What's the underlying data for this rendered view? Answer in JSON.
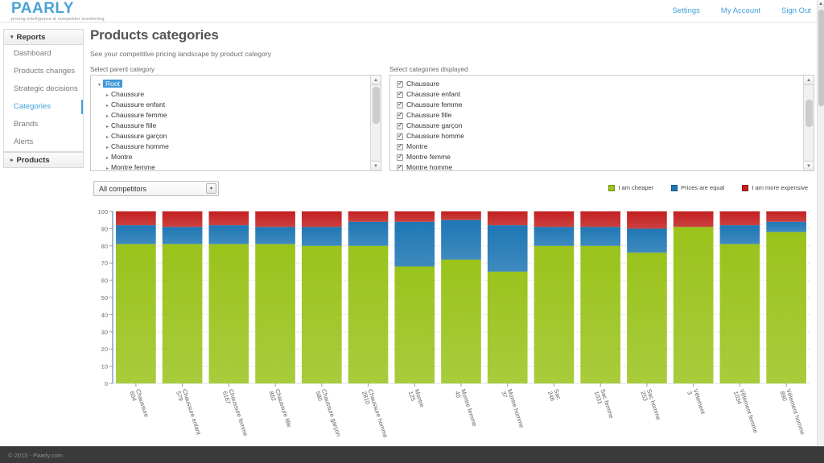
{
  "brand": {
    "name": "PAARLY",
    "tagline": "pricing intelligence & competitor monitoring",
    "accent": "#4aa3d8"
  },
  "topnav": [
    {
      "label": "Settings"
    },
    {
      "label": "My Account"
    },
    {
      "label": "Sign Out"
    }
  ],
  "sidebar": {
    "groups": [
      {
        "label": "Reports",
        "expanded": true,
        "caret": "▾",
        "items": [
          {
            "label": "Dashboard",
            "active": false
          },
          {
            "label": "Products changes",
            "active": false
          },
          {
            "label": "Strategic decisions",
            "active": false
          },
          {
            "label": "Categories",
            "active": true
          },
          {
            "label": "Brands",
            "active": false
          },
          {
            "label": "Alerts",
            "active": false
          }
        ]
      },
      {
        "label": "Products",
        "expanded": false,
        "caret": "▸",
        "items": []
      }
    ]
  },
  "page": {
    "title": "Products categories",
    "subtitle": "See your competitive pricing landscape by product category"
  },
  "parent_category_panel": {
    "label": "Select parent category",
    "root": {
      "label": "Root",
      "selected": true,
      "arrow": "▾"
    },
    "items": [
      {
        "label": "Chaussure",
        "arrow": "▸"
      },
      {
        "label": "Chaussure enfant",
        "arrow": "▸"
      },
      {
        "label": "Chaussure femme",
        "arrow": "▸"
      },
      {
        "label": "Chaussure fille",
        "arrow": "▸"
      },
      {
        "label": "Chaussure garçon",
        "arrow": "▸"
      },
      {
        "label": "Chaussure homme",
        "arrow": "▸"
      },
      {
        "label": "Montre",
        "arrow": "▸"
      },
      {
        "label": "Montre femme",
        "arrow": "▸"
      }
    ]
  },
  "displayed_categories_panel": {
    "label": "Select categories displayed",
    "items": [
      {
        "label": "Chaussure",
        "checked": true
      },
      {
        "label": "Chaussure enfant",
        "checked": true
      },
      {
        "label": "Chaussure femme",
        "checked": true
      },
      {
        "label": "Chaussure fille",
        "checked": true
      },
      {
        "label": "Chaussure garçon",
        "checked": true
      },
      {
        "label": "Chaussure homme",
        "checked": true
      },
      {
        "label": "Montre",
        "checked": true
      },
      {
        "label": "Montre femme",
        "checked": true
      },
      {
        "label": "Montre homme",
        "checked": true
      }
    ]
  },
  "competitor_select": {
    "value": "All competitors",
    "arrow": "▾"
  },
  "chart_data": {
    "type": "bar",
    "stacked": true,
    "title": "",
    "xlabel": "",
    "ylabel": "",
    "ylim": [
      0,
      100
    ],
    "yticks": [
      0,
      10,
      20,
      30,
      40,
      50,
      60,
      70,
      80,
      90,
      100
    ],
    "grid": true,
    "legend_position": "top-right",
    "categories": [
      "Chaussure\n604",
      "Chaussure enfant\n579",
      "Chaussure femme\n6167",
      "Chaussure fille\n862",
      "Chaussure garçon\n580",
      "Chaussure homme\n2810",
      "Montre\n125",
      "Montre femme\n40",
      "Montre homme\n37",
      "Sac\n246",
      "Sac femme\n1031",
      "Sac homme\n253",
      "Vêtement\n3",
      "Vêtement femme\n1034",
      "Vêtement homme\n890"
    ],
    "series": [
      {
        "name": "I am cheaper",
        "color": "#9ac31c",
        "values": [
          81,
          81,
          81,
          81,
          80,
          80,
          68,
          72,
          65,
          80,
          80,
          76,
          91,
          81,
          88
        ]
      },
      {
        "name": "Prices are equal",
        "color": "#1f77b4",
        "values": [
          11,
          10,
          11,
          10,
          11,
          14,
          26,
          23,
          27,
          11,
          11,
          14,
          0,
          11,
          6
        ]
      },
      {
        "name": "I am more expensive",
        "color": "#c32020",
        "values": [
          8,
          9,
          8,
          9,
          9,
          6,
          6,
          5,
          8,
          9,
          9,
          10,
          9,
          8,
          6
        ]
      }
    ]
  },
  "legend": [
    {
      "label": "I am cheaper",
      "color": "#9ac31c"
    },
    {
      "label": "Prices are equal",
      "color": "#1f77b4"
    },
    {
      "label": "I am more expensive",
      "color": "#c32020"
    }
  ],
  "footer": {
    "text": "© 2013 - Paarly.com"
  }
}
